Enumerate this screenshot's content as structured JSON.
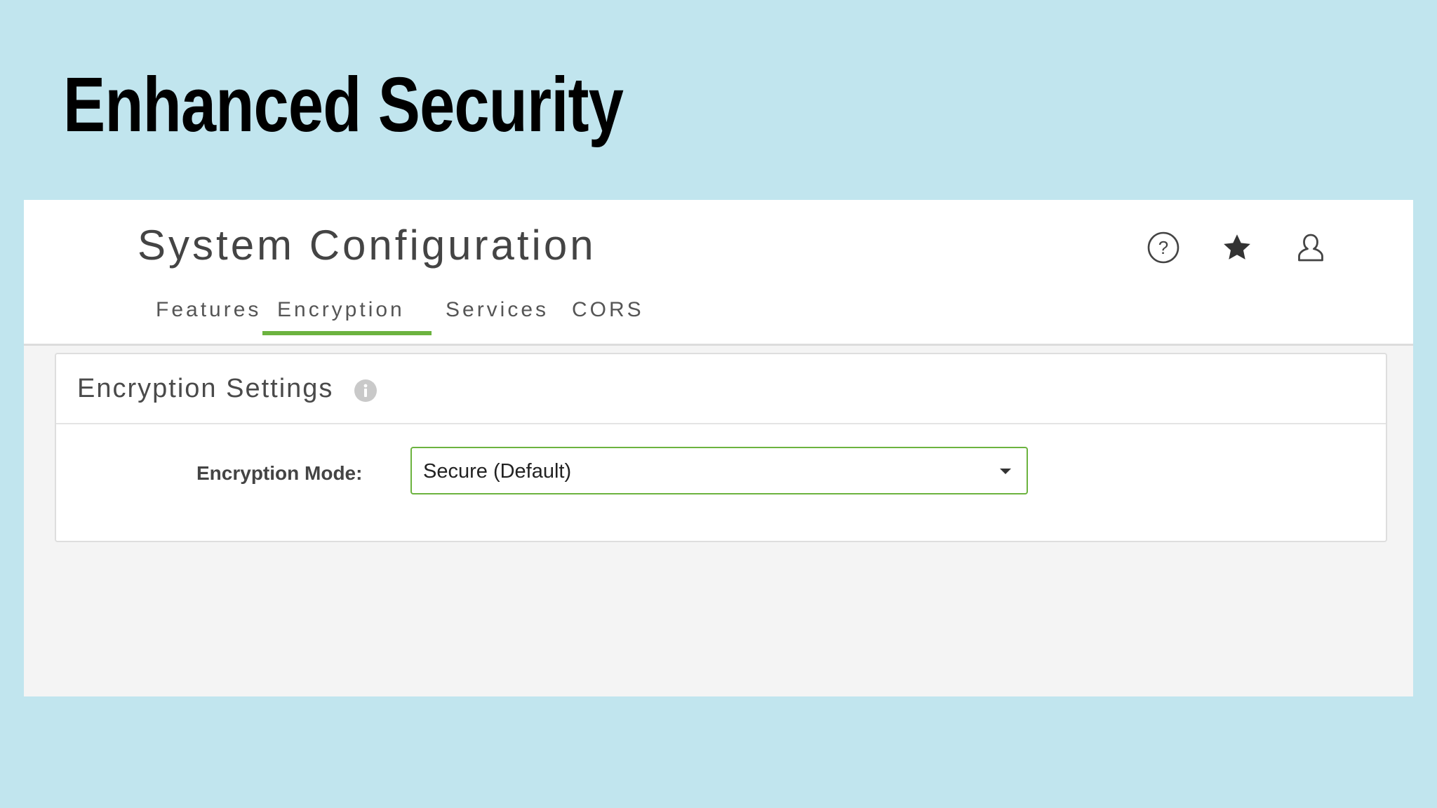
{
  "slide": {
    "title": "Enhanced Security"
  },
  "app": {
    "page_title": "System Configuration",
    "header_icons": [
      "help-icon",
      "star-icon",
      "user-icon"
    ],
    "tabs": [
      {
        "label": "Features",
        "active": false
      },
      {
        "label": "Encryption",
        "active": true
      },
      {
        "label": "Services",
        "active": false
      },
      {
        "label": "CORS",
        "active": false
      }
    ]
  },
  "panel": {
    "title": "Encryption Settings",
    "info_icon": "info-icon",
    "field": {
      "label": "Encryption Mode:",
      "selected_value": "Secure (Default)",
      "dropdown_icon": "chevron-down-icon"
    }
  },
  "colors": {
    "background": "#c1e5ee",
    "accent": "#6cb33f",
    "header_bg": "#ffffff",
    "content_bg": "#f4f4f4"
  }
}
